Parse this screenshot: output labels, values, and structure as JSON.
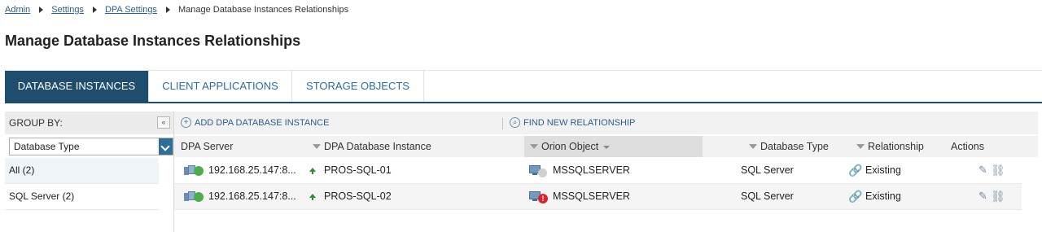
{
  "breadcrumb": {
    "items": [
      "Admin",
      "Settings",
      "DPA Settings"
    ],
    "current": "Manage Database Instances Relationships"
  },
  "page_title": "Manage Database Instances Relationships",
  "tabs": [
    {
      "label": "DATABASE INSTANCES",
      "active": true
    },
    {
      "label": "CLIENT APPLICATIONS",
      "active": false
    },
    {
      "label": "STORAGE OBJECTS",
      "active": false
    }
  ],
  "group_by": {
    "label": "GROUP BY:",
    "selected": "Database Type",
    "groups": [
      "All (2)",
      "SQL Server (2)"
    ]
  },
  "toolbar": {
    "add_label": "ADD DPA DATABASE INSTANCE",
    "find_label": "FIND NEW RELATIONSHIP"
  },
  "table": {
    "columns": [
      "DPA Server",
      "DPA Database Instance",
      "Orion Object",
      "Database Type",
      "Relationship",
      "Actions"
    ],
    "rows": [
      {
        "server": "192.168.25.147:8...",
        "instance": "PROS-SQL-01",
        "orion": "MSSQLSERVER",
        "db_type": "SQL Server",
        "relationship": "Existing",
        "orion_status": "unknown"
      },
      {
        "server": "192.168.25.147:8...",
        "instance": "PROS-SQL-02",
        "orion": "MSSQLSERVER",
        "db_type": "SQL Server",
        "relationship": "Existing",
        "orion_status": "critical"
      }
    ]
  },
  "colors": {
    "accent": "#1f4d6e",
    "link": "#2a5e8c",
    "up": "#4cae4c",
    "critical": "#d6262e"
  }
}
